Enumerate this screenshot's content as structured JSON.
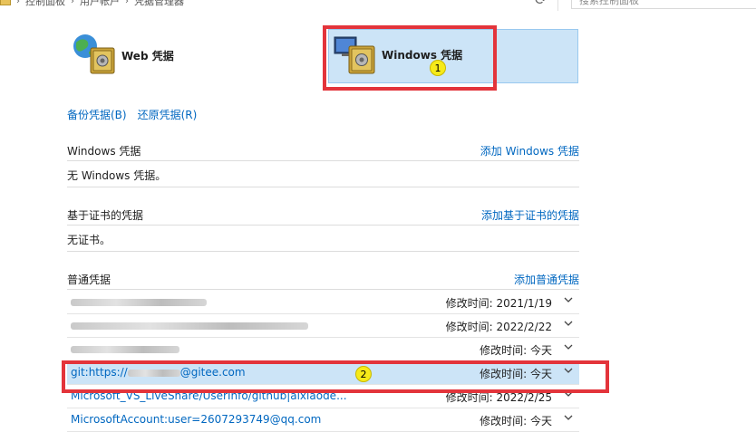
{
  "breadcrumb": [
    "控制面板",
    "用户帐户",
    "凭据管理器"
  ],
  "search_placeholder": "搜索控制面板",
  "header": {
    "web_label": "Web 凭据",
    "windows_label": "Windows 凭据"
  },
  "badges": {
    "b1": "1",
    "b2": "2"
  },
  "actions": {
    "backup": "备份凭据(B)",
    "restore": "还原凭据(R)"
  },
  "windows_section": {
    "title": "Windows 凭据",
    "add": "添加 Windows 凭据",
    "empty": "无 Windows 凭据。"
  },
  "cert_section": {
    "title": "基于证书的凭据",
    "add": "添加基于证书的凭据",
    "empty": "无证书。"
  },
  "generic_section": {
    "title": "普通凭据",
    "add": "添加普通凭据"
  },
  "credentials": [
    {
      "name": "",
      "date": "修改时间:  2021/1/19"
    },
    {
      "name": "",
      "date": "修改时间:  2022/2/22"
    },
    {
      "name": "",
      "date": "修改时间:  今天"
    },
    {
      "name": "git:https://",
      "name2": "@gitee.com",
      "date": "修改时间:  今天"
    },
    {
      "name": "Microsoft_VS_LiveShare/UserInfo/github|aixiaode...",
      "date": "修改时间:  2022/2/25"
    },
    {
      "name": "MicrosoftAccount:user=2607293749@qq.com",
      "date": "修改时间:  今天"
    }
  ],
  "colors": {
    "link": "#0067c0",
    "selected_bg": "#cce4f7",
    "highlight_red": "#e3343b",
    "badge_yellow": "#f6ea19"
  }
}
